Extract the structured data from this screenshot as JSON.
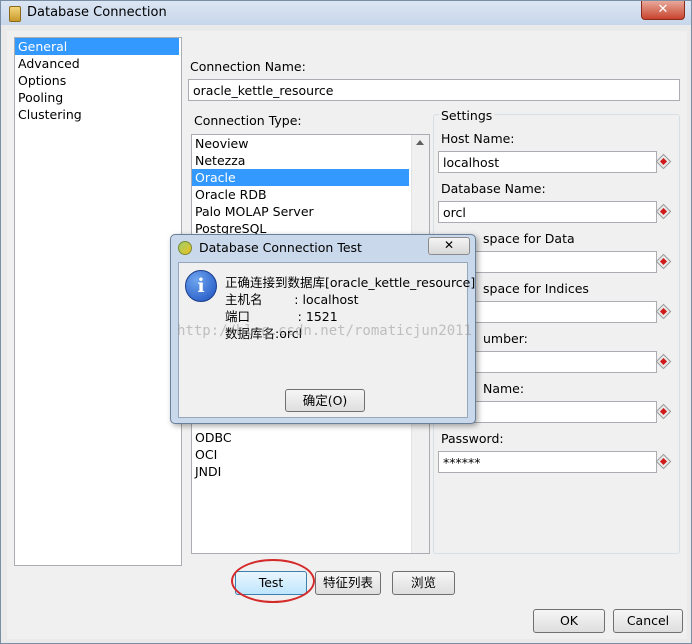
{
  "window": {
    "title": "Database Connection",
    "close_glyph": "✕"
  },
  "nav": {
    "items": [
      "General",
      "Advanced",
      "Options",
      "Pooling",
      "Clustering"
    ],
    "selected_index": 0
  },
  "connection_name": {
    "label": "Connection Name:",
    "value": "oracle_kettle_resource"
  },
  "connection_type": {
    "label": "Connection Type:",
    "items_top": [
      "Neoview",
      "Netezza",
      "Oracle",
      "Oracle RDB",
      "Palo MOLAP Server",
      "PostgreSQL"
    ],
    "selected": "Oracle"
  },
  "access": {
    "items": [
      "ODBC",
      "OCI",
      "JNDI"
    ]
  },
  "settings": {
    "title": "Settings",
    "host_label": "Host Name:",
    "host_value": "localhost",
    "db_label": "Database Name:",
    "db_value": "orcl",
    "tablespace_data_label": "space for Data",
    "tablespace_indices_label": "space for Indices",
    "port_label": "umber:",
    "username_label": "Name:",
    "password_label": "Password:",
    "password_value": "******"
  },
  "buttons": {
    "test": "Test",
    "features": "特征列表",
    "explore": "浏览",
    "ok": "OK",
    "cancel": "Cancel"
  },
  "dialog": {
    "title": "Database Connection Test",
    "close_glyph": "✕",
    "lines": [
      "正确连接到数据库[oracle_kettle_resource]",
      "主机名        : localhost",
      "端口            : 1521",
      "数据库名:orcl"
    ],
    "ok_label": "确定(O)"
  },
  "watermark": "http://blog.csdn.net/romaticjun2011"
}
